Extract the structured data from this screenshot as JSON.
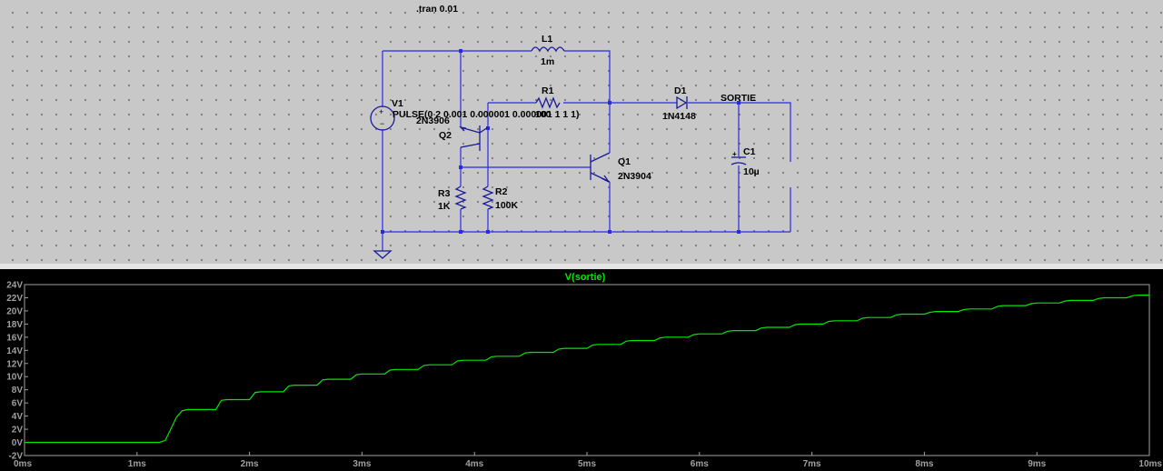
{
  "schematic": {
    "directive": ".tran 0.01",
    "components": {
      "v1": {
        "name": "V1",
        "value": "PULSE(0 2 0.001 0.000001 0.000001 1 1 1)"
      },
      "l1": {
        "name": "L1",
        "value": "1m"
      },
      "r1": {
        "name": "R1",
        "value": "100"
      },
      "d1": {
        "name": "D1",
        "value": "1N4148"
      },
      "c1": {
        "name": "C1",
        "value": "10µ"
      },
      "q1": {
        "name": "Q1",
        "value": "2N3904"
      },
      "q2": {
        "name": "Q2",
        "value": "2N3906"
      },
      "r2": {
        "name": "R2",
        "value": "100K"
      },
      "r3": {
        "name": "R3",
        "value": "1K"
      }
    },
    "net_label": "SORTIE",
    "colors": {
      "wire": "#2a2ae6",
      "background": "#c8c8c8"
    }
  },
  "plot": {
    "trace_title": "V(sortie)",
    "trace_color": "#00e600",
    "background": "#000000"
  },
  "chart_data": {
    "type": "line",
    "title": "V(sortie)",
    "xlabel": "",
    "ylabel": "",
    "xlim": [
      0,
      10
    ],
    "ylim": [
      -2,
      24
    ],
    "x_ticks": [
      "0ms",
      "1ms",
      "2ms",
      "3ms",
      "4ms",
      "5ms",
      "6ms",
      "7ms",
      "8ms",
      "9ms",
      "10ms"
    ],
    "y_ticks": [
      "-2V",
      "0V",
      "2V",
      "4V",
      "6V",
      "8V",
      "10V",
      "12V",
      "14V",
      "16V",
      "18V",
      "20V",
      "22V",
      "24V"
    ],
    "grid": false,
    "series": [
      {
        "name": "V(sortie)",
        "x": [
          0,
          1.0,
          1.2,
          1.25,
          1.3,
          1.35,
          1.4,
          1.45,
          1.5,
          1.7,
          1.75,
          1.8,
          2.0,
          2.05,
          2.1,
          2.3,
          2.35,
          2.4,
          2.6,
          2.65,
          2.7,
          2.9,
          2.95,
          3.0,
          3.2,
          3.25,
          3.3,
          3.5,
          3.55,
          3.6,
          3.8,
          3.85,
          3.9,
          4.1,
          4.15,
          4.2,
          4.4,
          4.45,
          4.5,
          4.7,
          4.75,
          4.8,
          5.0,
          5.05,
          5.1,
          5.3,
          5.35,
          5.4,
          5.6,
          5.65,
          5.7,
          5.9,
          5.95,
          6.0,
          6.2,
          6.25,
          6.3,
          6.5,
          6.55,
          6.6,
          6.8,
          6.85,
          6.9,
          7.1,
          7.15,
          7.2,
          7.4,
          7.45,
          7.5,
          7.7,
          7.75,
          7.8,
          8.0,
          8.05,
          8.1,
          8.3,
          8.35,
          8.4,
          8.6,
          8.65,
          8.7,
          8.9,
          8.95,
          9.0,
          9.2,
          9.25,
          9.3,
          9.5,
          9.55,
          9.6,
          9.8,
          9.85,
          9.9,
          10.0
        ],
        "y": [
          0,
          0,
          0,
          0.3,
          2.0,
          3.8,
          4.8,
          5.0,
          5.0,
          5.0,
          6.4,
          6.5,
          6.5,
          7.6,
          7.7,
          7.7,
          8.6,
          8.7,
          8.7,
          9.5,
          9.6,
          9.6,
          10.3,
          10.4,
          10.4,
          11.0,
          11.1,
          11.1,
          11.7,
          11.8,
          11.8,
          12.4,
          12.5,
          12.5,
          13.0,
          13.1,
          13.1,
          13.6,
          13.7,
          13.7,
          14.2,
          14.3,
          14.3,
          14.8,
          14.9,
          14.9,
          15.4,
          15.5,
          15.5,
          15.9,
          16.0,
          16.0,
          16.4,
          16.5,
          16.5,
          16.9,
          17.0,
          17.0,
          17.4,
          17.5,
          17.5,
          17.9,
          18.0,
          18.0,
          18.4,
          18.5,
          18.5,
          18.9,
          19.0,
          19.0,
          19.4,
          19.5,
          19.5,
          19.8,
          19.9,
          19.9,
          20.2,
          20.3,
          20.3,
          20.7,
          20.8,
          20.8,
          21.1,
          21.2,
          21.2,
          21.5,
          21.6,
          21.6,
          21.9,
          22.0,
          22.0,
          22.3,
          22.4,
          22.4
        ]
      }
    ]
  }
}
